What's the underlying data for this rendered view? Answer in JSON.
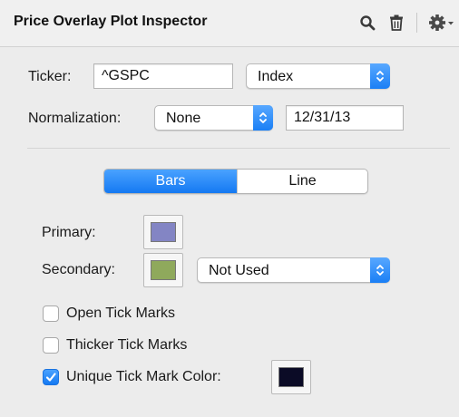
{
  "panel": {
    "title": "Price Overlay Plot Inspector",
    "icons": [
      "search-icon",
      "trash-icon",
      "gear-icon",
      "chevron-down-icon"
    ]
  },
  "ticker": {
    "label": "Ticker:",
    "value": "^GSPC"
  },
  "type_popup": {
    "value": "Index"
  },
  "normalization": {
    "label": "Normalization:",
    "value": "None",
    "date": "12/31/13"
  },
  "style_toggle": {
    "options": [
      "Bars",
      "Line"
    ],
    "selected": "Bars"
  },
  "primary": {
    "label": "Primary:",
    "color": "#8385c4"
  },
  "secondary": {
    "label": "Secondary:",
    "color": "#8fa95c",
    "mode": "Not Used"
  },
  "checkboxes": [
    {
      "label": "Open Tick Marks",
      "checked": false
    },
    {
      "label": "Thicker Tick Marks",
      "checked": false
    },
    {
      "label": "Unique Tick Mark Color:",
      "checked": true
    }
  ],
  "tick_color": "#0b0b26",
  "colors": {
    "accent": "#1a7ff5"
  }
}
